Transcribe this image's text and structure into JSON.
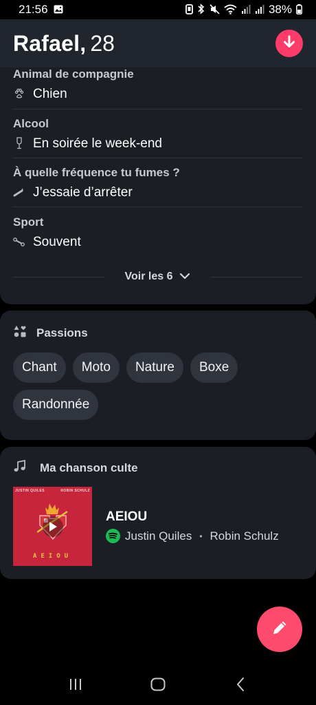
{
  "status_bar": {
    "time": "21:56",
    "battery": "38%",
    "icons": [
      "photo-icon",
      "nfc-icon",
      "bluetooth-icon",
      "mute-icon",
      "wifi-icon",
      "signal-icon",
      "signal-icon",
      "battery-icon"
    ]
  },
  "header": {
    "name": "Rafael,",
    "age": "28",
    "collapse_icon": "arrow-down-icon",
    "accent": "#fe3c6a"
  },
  "lifestyle": {
    "items": [
      {
        "title": "Animal de compagnie",
        "value": "Chien",
        "icon": "paw-icon"
      },
      {
        "title": "Alcool",
        "value": "En soirée le week-end",
        "icon": "wine-glass-icon"
      },
      {
        "title": "À quelle fréquence tu fumes ?",
        "value": "J’essaie d’arrêter",
        "icon": "cigarette-icon"
      },
      {
        "title": "Sport",
        "value": "Souvent",
        "icon": "dumbbell-icon"
      }
    ],
    "more_label": "Voir les 6"
  },
  "passions": {
    "title": "Passions",
    "chips": [
      "Chant",
      "Moto",
      "Nature",
      "Boxe",
      "Randonnée"
    ]
  },
  "song": {
    "title": "Ma chanson culte",
    "track": "AEIOU",
    "artist_1": "Justin Quiles",
    "artist_2": "Robin Schulz",
    "separator": "•",
    "cover_left": "JUSTIN QUILES",
    "cover_right": "ROBIN SCHULZ",
    "cover_word": "AEIOU",
    "cover_color": "#c6253b",
    "spotify_color": "#1db954"
  },
  "fab": {
    "icon": "pencil-icon",
    "color": "#fe4a6d"
  },
  "navbar": {
    "icons": [
      "recent-apps-icon",
      "home-icon",
      "back-icon"
    ]
  }
}
